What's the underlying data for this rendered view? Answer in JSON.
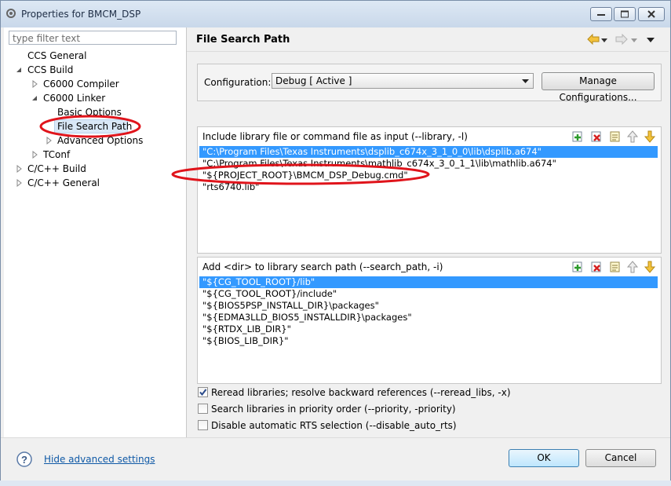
{
  "window": {
    "title": "Properties for BMCM_DSP"
  },
  "left": {
    "filter_placeholder": "type filter text",
    "tree": [
      {
        "label": "CCS General"
      },
      {
        "label": "CCS Build"
      },
      {
        "label": "C6000 Compiler"
      },
      {
        "label": "C6000 Linker"
      },
      {
        "label": "Basic Options"
      },
      {
        "label": "File Search Path"
      },
      {
        "label": "Advanced Options"
      },
      {
        "label": "TConf"
      },
      {
        "label": "C/C++ Build"
      },
      {
        "label": "C/C++ General"
      }
    ]
  },
  "page": {
    "title": "File Search Path"
  },
  "configuration": {
    "label": "Configuration:",
    "selected": "Debug  [ Active ]",
    "manage_label": "Manage Configurations..."
  },
  "include_list": {
    "title": "Include library file or command file as input (--library, -l)",
    "items": [
      "\"C:\\Program Files\\Texas Instruments\\dsplib_c674x_3_1_0_0\\lib\\dsplib.a674\"",
      "\"C:\\Program Files\\Texas Instruments\\mathlib_c674x_3_0_1_1\\lib\\mathlib.a674\"",
      "\"${PROJECT_ROOT}\\BMCM_DSP_Debug.cmd\"",
      "\"rts6740.lib\""
    ]
  },
  "search_list": {
    "title": "Add <dir> to library search path (--search_path, -i)",
    "items": [
      "\"${CG_TOOL_ROOT}/lib\"",
      "\"${CG_TOOL_ROOT}/include\"",
      "\"${BIOS5PSP_INSTALL_DIR}\\packages\"",
      "\"${EDMA3LLD_BIOS5_INSTALLDIR}\\packages\"",
      "\"${RTDX_LIB_DIR}\"",
      "\"${BIOS_LIB_DIR}\""
    ]
  },
  "options": [
    {
      "label": "Reread libraries; resolve backward references (--reread_libs, -x)",
      "checked": true
    },
    {
      "label": "Search libraries in priority order (--priority, -priority)",
      "checked": false
    },
    {
      "label": "Disable automatic RTS selection (--disable_auto_rts)",
      "checked": false
    }
  ],
  "footer": {
    "hide_advanced": "Hide advanced settings",
    "ok_label": "OK",
    "cancel_label": "Cancel"
  },
  "icons": {
    "app": "eclipse-gear-icon",
    "back": "back-arrow-icon",
    "forward": "forward-arrow-icon",
    "menu": "view-menu-icon",
    "add": "add-icon",
    "delete": "delete-icon",
    "edit": "edit-icon",
    "move_up": "move-up-icon",
    "move_down": "move-down-icon",
    "help": "help-icon"
  },
  "colors": {
    "selection": "#3399ff",
    "annotation": "#e0141b",
    "link": "#0f59a6"
  }
}
